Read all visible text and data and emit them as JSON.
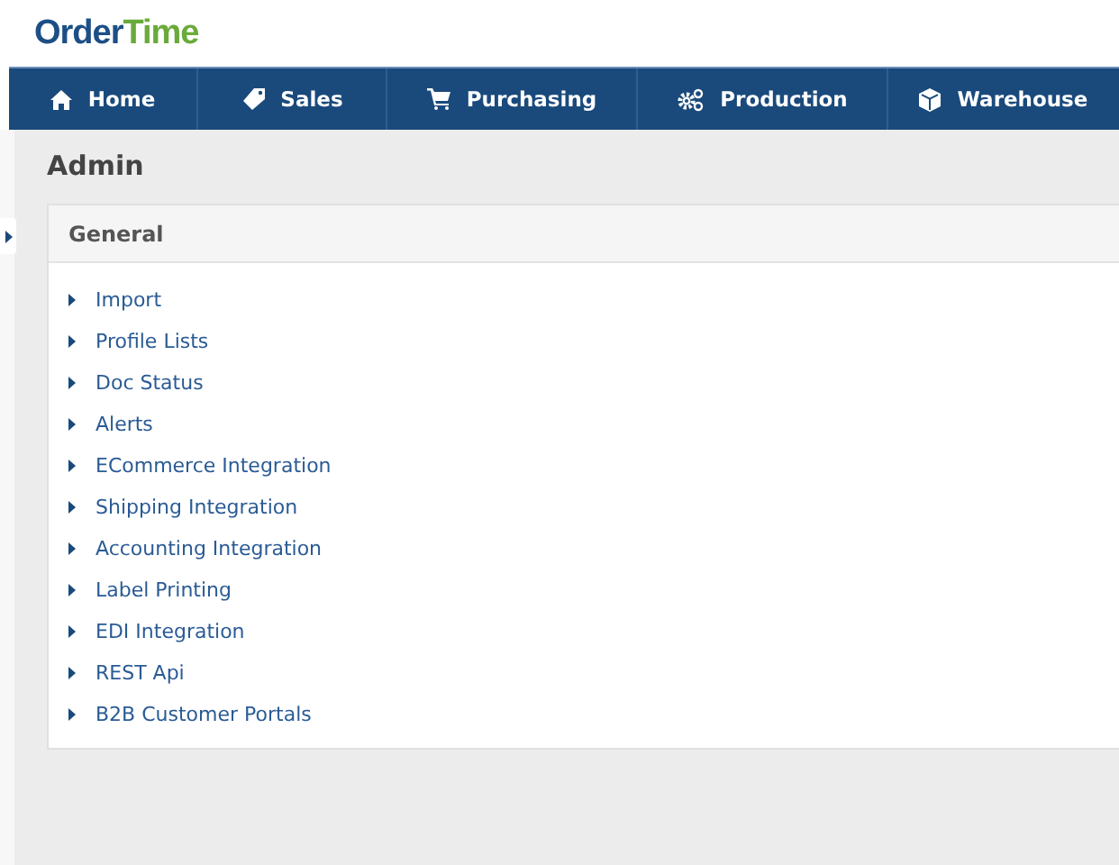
{
  "logo": {
    "first": "Order",
    "second": "Time"
  },
  "nav": [
    {
      "label": "Home",
      "kind": "home"
    },
    {
      "label": "Sales",
      "kind": "tag"
    },
    {
      "label": "Purchasing",
      "kind": "cart"
    },
    {
      "label": "Production",
      "kind": "gears"
    },
    {
      "label": "Warehouse",
      "kind": "cube"
    }
  ],
  "page_title": "Admin",
  "panel": {
    "title": "General",
    "items": [
      "Import",
      "Profile Lists",
      "Doc Status",
      "Alerts",
      "ECommerce Integration",
      "Shipping Integration",
      "Accounting Integration",
      "Label Printing",
      "EDI Integration",
      "REST Api",
      "B2B Customer Portals"
    ]
  }
}
